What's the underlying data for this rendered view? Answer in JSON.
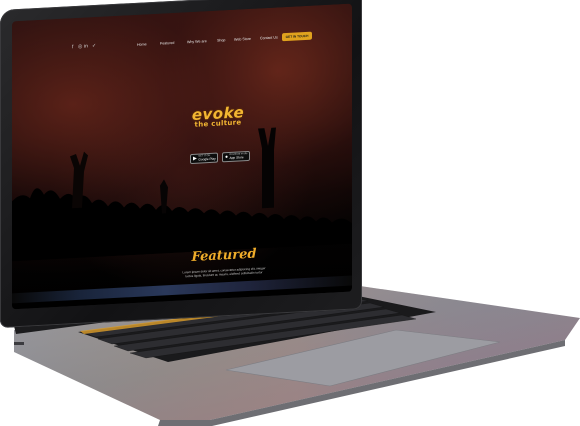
{
  "nav": {
    "social_icons": [
      "facebook-icon",
      "instagram-icon",
      "linkedin-icon",
      "twitter-icon"
    ],
    "social_glyphs": [
      "f",
      "◎",
      "in",
      "✓"
    ],
    "items": [
      "Home",
      "Featured",
      "Why We are",
      "Shop",
      "Web Store",
      "Contact Us"
    ],
    "cta": "GET IN TOUCH"
  },
  "hero": {
    "logo_main": "evoke",
    "logo_sub": "the culture"
  },
  "badges": {
    "google_small": "GET IT ON",
    "google": "Google Play",
    "apple_small": "Download on the",
    "apple": "App Store"
  },
  "featured": {
    "title": "Featured",
    "text_line1": "Lorem ipsum dolor sit amet, consectetur adipiscing elit, integer",
    "text_line2": "luctus ligula, tincidunt ac mauris, eleifend sollicitudin tortor"
  },
  "colors": {
    "accent": "#e0a21e",
    "logo": "#f2b632",
    "featured": "#f0ad2a"
  }
}
